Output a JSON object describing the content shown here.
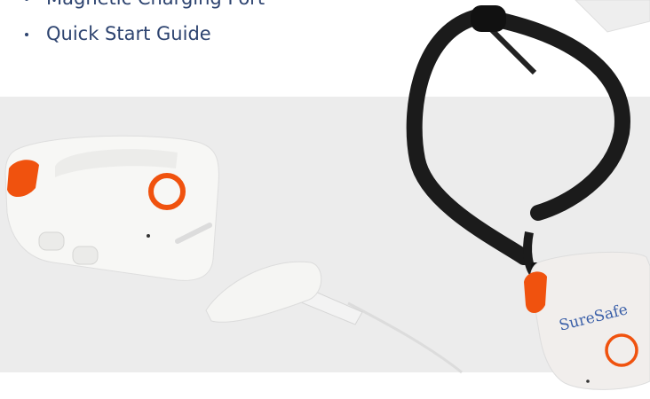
{
  "contents_list": {
    "items": [
      "Magnetic Charging Port",
      "Quick Start Guide"
    ]
  },
  "photo": {
    "brand_text": "SureSafe",
    "colors": {
      "background_panel": "#ececec",
      "device_body": "#f7f7f5",
      "accent_orange": "#f0520e",
      "lanyard": "#1b1b1b",
      "text_navy": "#2e4470"
    }
  }
}
